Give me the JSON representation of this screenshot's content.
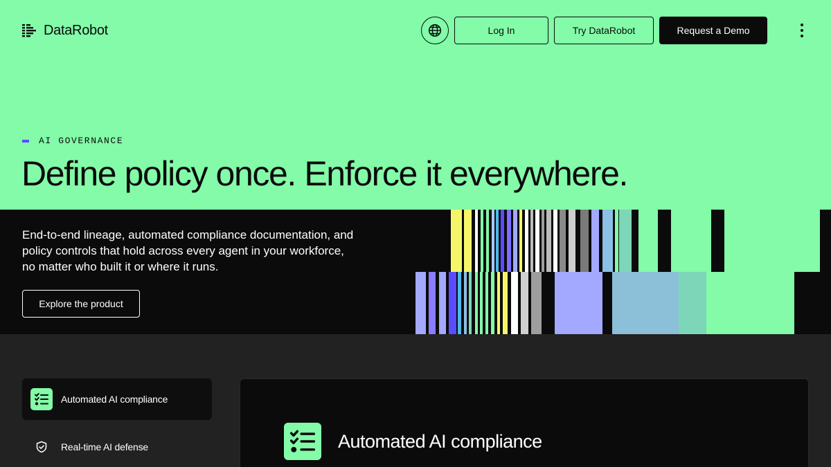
{
  "header": {
    "logo_text": "DataRobot",
    "globe_icon": "globe-icon",
    "login_label": "Log In",
    "try_label": "Try DataRobot",
    "demo_label": "Request a Demo",
    "menu_icon": "kebab-menu-icon"
  },
  "hero": {
    "eyebrow": "AI GOVERNANCE",
    "title": "Define policy once. Enforce it everywhere.",
    "description": "End-to-end lineage, automated compliance documentation, and policy controls that hold across every agent in your workforce, no matter who built it or where it runs.",
    "cta_label": "Explore the product"
  },
  "sidebar": {
    "items": [
      {
        "label": "Automated AI compliance",
        "icon": "checklist-icon",
        "active": true
      },
      {
        "label": "Real-time AI defense",
        "icon": "shield-check-icon",
        "active": false
      }
    ]
  },
  "panel": {
    "title": "Automated AI compliance",
    "icon": "checklist-icon"
  },
  "colors": {
    "brand_green": "#83fba8",
    "accent_purple": "#5b4cff",
    "background_dark": "#0b0b0b",
    "lower_bg": "#222222"
  }
}
